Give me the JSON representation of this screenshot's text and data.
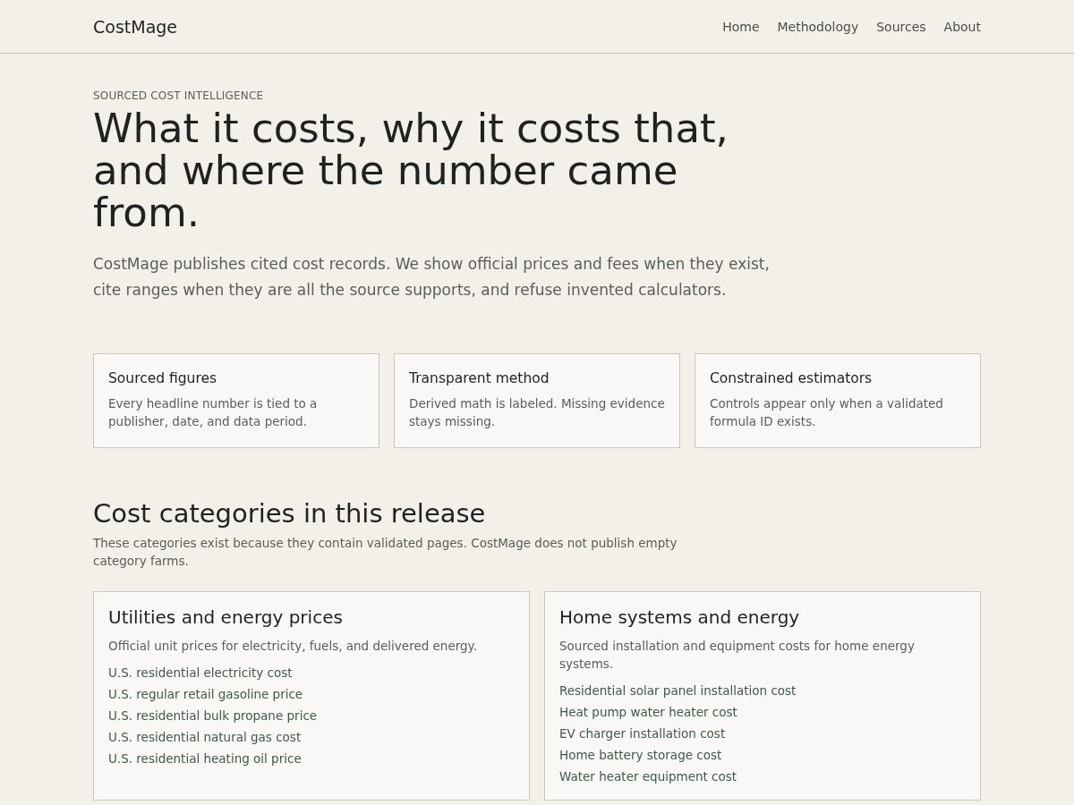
{
  "header": {
    "brand": "CostMage",
    "nav": [
      {
        "label": "Home"
      },
      {
        "label": "Methodology"
      },
      {
        "label": "Sources"
      },
      {
        "label": "About"
      }
    ]
  },
  "hero": {
    "eyebrow": "SOURCED COST INTELLIGENCE",
    "title": "What it costs, why it costs that, and where the number came from.",
    "lead": "CostMage publishes cited cost records. We show official prices and fees when they exist, cite ranges when they are all the source supports, and refuse invented calculators."
  },
  "features": [
    {
      "title": "Sourced figures",
      "text": "Every headline number is tied to a publisher, date, and data period."
    },
    {
      "title": "Transparent method",
      "text": "Derived math is labeled. Missing evidence stays missing."
    },
    {
      "title": "Constrained estimators",
      "text": "Controls appear only when a validated formula ID exists."
    }
  ],
  "categories_section": {
    "title": "Cost categories in this release",
    "intro": "These categories exist because they contain validated pages. CostMage does not publish empty category farms."
  },
  "categories": [
    {
      "title": "Utilities and energy prices",
      "description": "Official unit prices for electricity, fuels, and delivered energy.",
      "links": [
        "U.S. residential electricity cost",
        "U.S. regular retail gasoline price",
        "U.S. residential bulk propane price",
        "U.S. residential natural gas cost",
        "U.S. residential heating oil price"
      ]
    },
    {
      "title": "Home systems and energy",
      "description": "Sourced installation and equipment costs for home energy systems.",
      "links": [
        "Residential solar panel installation cost",
        "Heat pump water heater cost",
        "EV charger installation cost",
        "Home battery storage cost",
        "Water heater equipment cost"
      ]
    }
  ]
}
